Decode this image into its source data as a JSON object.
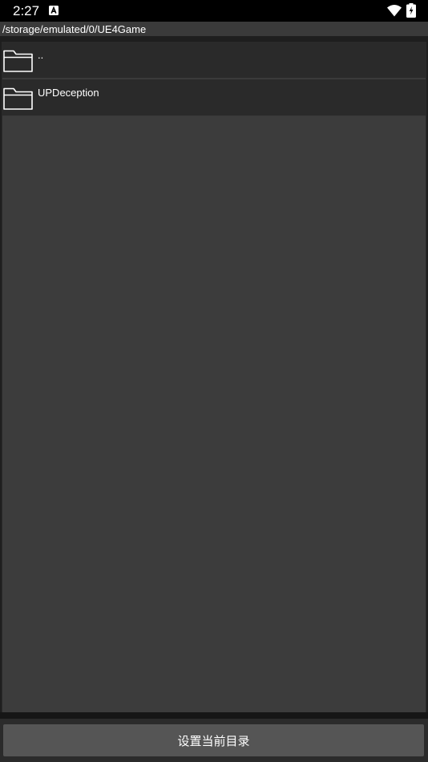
{
  "status_bar": {
    "time": "2:27",
    "notification_icon": "a-notification-icon",
    "wifi_icon": "wifi-icon",
    "battery_icon": "battery-charging-icon"
  },
  "path": "/storage/emulated/0/UE4Game",
  "files": [
    {
      "name": "..",
      "icon": "folder-icon"
    },
    {
      "name": "UPDeception",
      "icon": "folder-icon"
    }
  ],
  "action_button": {
    "label": "设置当前目录"
  },
  "colors": {
    "status_bar_bg": "#000000",
    "path_bar_bg": "#3a3a3a",
    "row_bg": "#2a2a2a",
    "list_bg": "#3c3c3c",
    "button_bg": "#555555",
    "text": "#ffffff"
  }
}
